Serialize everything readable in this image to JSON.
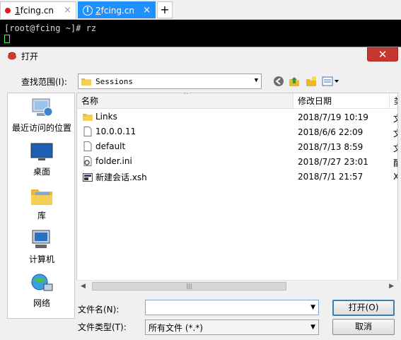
{
  "tabs": [
    {
      "label": "1 fcing.cn",
      "num": "1",
      "rest": " fcing.cn",
      "close": "×"
    },
    {
      "label": "2 fcing.cn",
      "num": "2",
      "rest": " fcing.cn",
      "close": "×",
      "badge": "!"
    }
  ],
  "new_tab": "+",
  "terminal": {
    "prompt": "[root@fcing ~]# rz"
  },
  "dialog": {
    "title": "打开",
    "close": "✕",
    "look_in_label": "查找范围(I):",
    "look_in_value": "Sessions",
    "places": [
      "最近访问的位置",
      "桌面",
      "库",
      "计算机",
      "网络"
    ],
    "columns": {
      "name": "名称",
      "date": "修改日期",
      "type": "类"
    },
    "files": [
      {
        "name": "Links",
        "date": "2018/7/19 10:19",
        "type": "文",
        "icon": "folder-icon"
      },
      {
        "name": "10.0.0.11",
        "date": "2018/6/6 22:09",
        "type": "文",
        "icon": "file-icon"
      },
      {
        "name": "default",
        "date": "2018/7/13 8:59",
        "type": "文",
        "icon": "file-icon"
      },
      {
        "name": "folder.ini",
        "date": "2018/7/27 23:01",
        "type": "配",
        "icon": "settings-file-icon"
      },
      {
        "name": "新建会话.xsh",
        "date": "2018/7/1 21:57",
        "type": "X",
        "icon": "xsh-file-icon"
      }
    ],
    "scroll_grip": "|||",
    "filename_label": "文件名(N):",
    "filename_value": "",
    "filetype_label": "文件类型(T):",
    "filetype_value": "所有文件 (*.*)",
    "open_button": "打开(O)",
    "cancel_button": "取消"
  },
  "colors": {
    "tab_active": "#1e90ff",
    "close_red": "#c7372f",
    "terminal_bg": "#000000"
  }
}
